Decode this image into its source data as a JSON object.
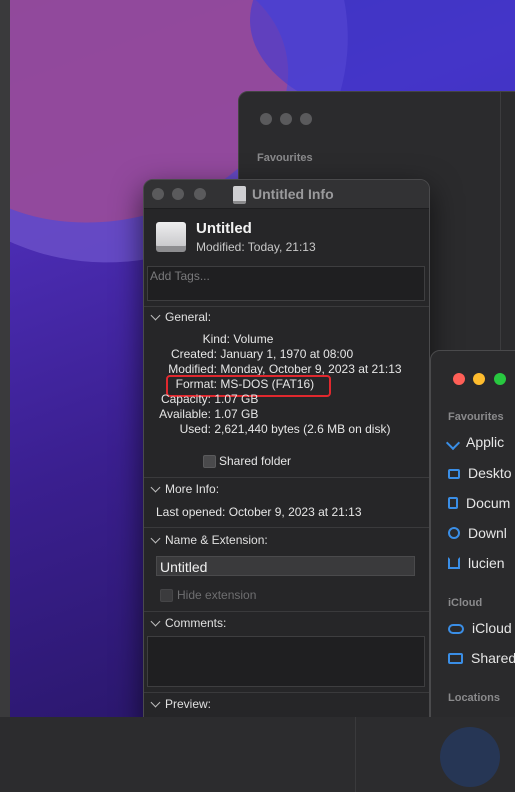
{
  "info_window": {
    "title": "Untitled Info",
    "volume_name": "Untitled",
    "modified_header": "Modified: Today, 21:13",
    "tags_placeholder": "Add Tags...",
    "general": {
      "header": "General:",
      "kind_label": "Kind:",
      "kind_value": "Volume",
      "created_label": "Created:",
      "created_value": "January 1, 1970 at 08:00",
      "modified_label": "Modified:",
      "modified_value": "Monday, October 9, 2023 at 21:13",
      "format_label": "Format:",
      "format_value": "MS-DOS (FAT16)",
      "capacity_label": "Capacity:",
      "capacity_value": "1.07 GB",
      "available_label": "Available:",
      "available_value": "1.07 GB",
      "used_label": "Used:",
      "used_value": "2,621,440 bytes (2.6 MB on disk)",
      "shared_folder": "Shared folder"
    },
    "more_info": {
      "header": "More Info:",
      "last_opened": "Last opened: October 9, 2023 at 21:13"
    },
    "name_ext": {
      "header": "Name & Extension:",
      "name_value": "Untitled",
      "hide_extension": "Hide extension"
    },
    "comments": {
      "header": "Comments:"
    },
    "preview": {
      "header": "Preview:"
    }
  },
  "back_finder": {
    "favourites": "Favourites"
  },
  "front_finder": {
    "favourites": "Favourites",
    "items": [
      "Applic",
      "Deskto",
      "Docum",
      "Downl",
      "lucien"
    ],
    "icloud_section": "iCloud",
    "icloud_items": [
      "iCloud",
      "Shared"
    ],
    "locations_section": "Locations"
  },
  "colors": {
    "highlight_box": "#e0282e",
    "accent_blue": "#3a8ee6",
    "traffic_red": "#ff5f57",
    "traffic_yellow": "#febc2e",
    "traffic_green": "#28c840"
  }
}
